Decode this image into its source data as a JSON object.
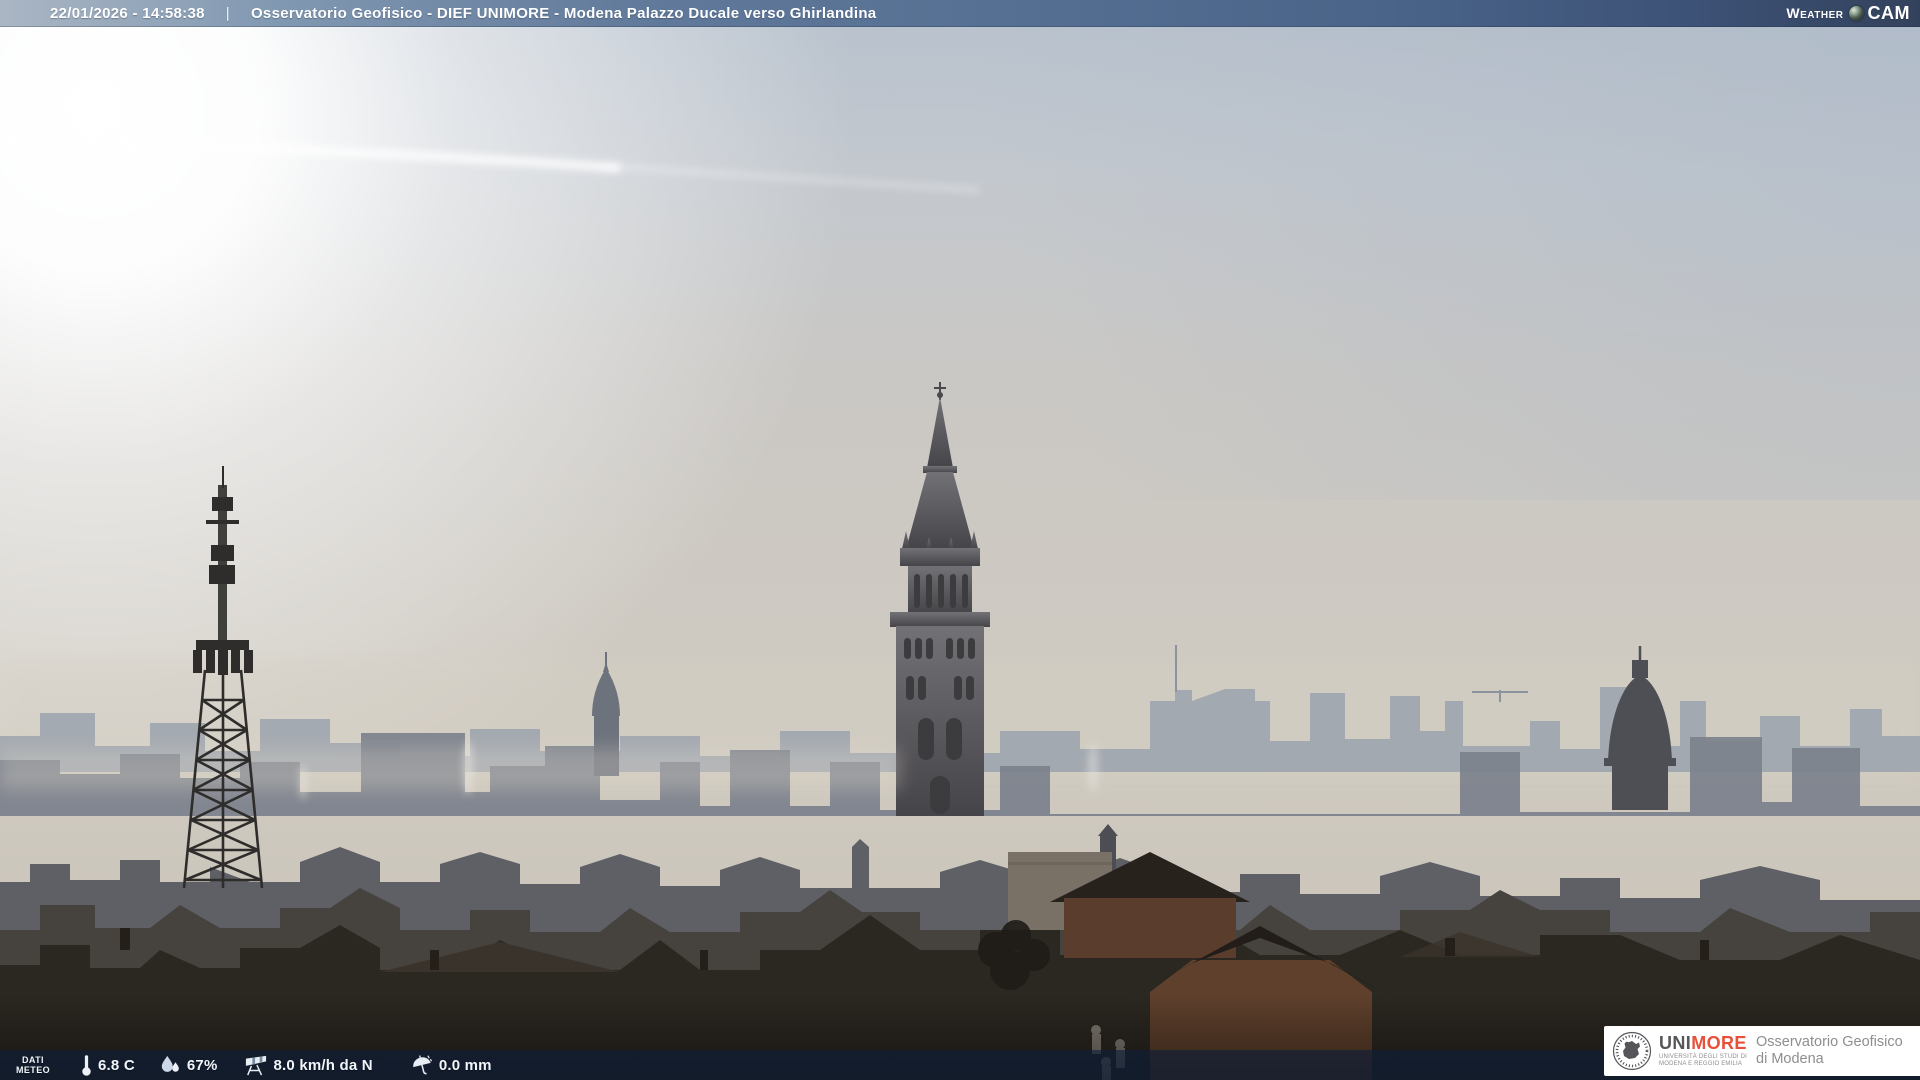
{
  "header": {
    "timestamp": "22/01/2026 - 14:58:38",
    "separator": "|",
    "title": "Osservatorio Geofisico - DIEF UNIMORE - Modena Palazzo Ducale verso Ghirlandina",
    "brand": {
      "weather": "Weather",
      "cam": "CAM",
      "lens_icon": "camera-lens-icon"
    }
  },
  "footer": {
    "label_line1": "DATI",
    "label_line2": "METEO",
    "temperature": "6.8 C",
    "humidity": "67%",
    "wind": "8.0 km/h da N",
    "rain": "0.0 mm",
    "icons": {
      "temperature": "thermometer-icon",
      "humidity": "water-drops-icon",
      "wind": "windsock-icon",
      "rain": "umbrella-rain-icon"
    }
  },
  "logo_card": {
    "acronym_uni": "UNI",
    "acronym_more": "MORE",
    "subtitle_line1": "UNIVERSITÀ DEGLI STUDI DI",
    "subtitle_line2": "MODENA E REGGIO EMILIA",
    "right_line1": "Osservatorio Geofisico",
    "right_line2": "di Modena",
    "seal_icon": "unimore-seal-icon"
  },
  "scene": {
    "landmarks": {
      "center": "ghirlandina-tower",
      "left": "communications-mast",
      "midleft": "church-spire",
      "right": "church-dome",
      "sky": "sun-glare-and-contrail"
    }
  },
  "colors": {
    "topbar_left": "#aab6c4",
    "topbar_right": "#33425c",
    "footer_bar": "#0d1e3a",
    "unimore_red": "#e8503a",
    "card_bg": "#ffffff"
  }
}
